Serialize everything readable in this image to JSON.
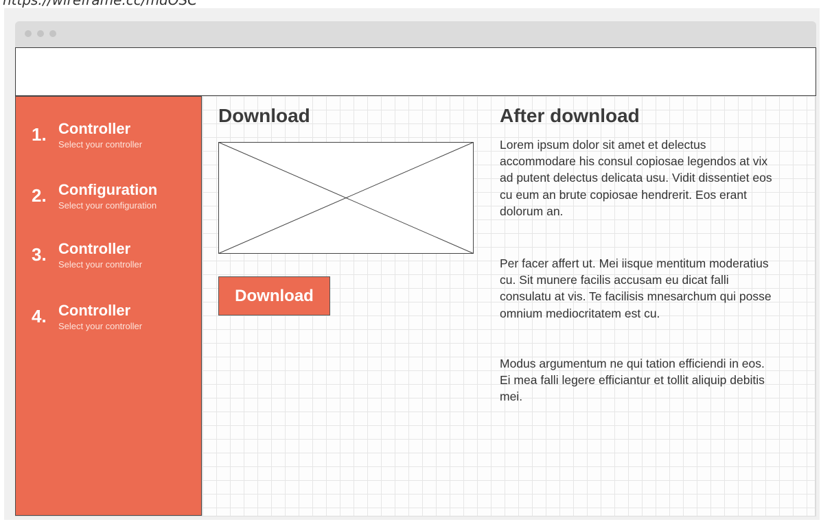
{
  "browser": {
    "url": "https://wireframe.cc/mdOSC"
  },
  "sidebar": {
    "steps": [
      {
        "number": "1.",
        "title": "Controller",
        "subtitle": "Select your controller"
      },
      {
        "number": "2.",
        "title": "Configuration",
        "subtitle": "Select your configuration"
      },
      {
        "number": "3.",
        "title": "Controller",
        "subtitle": "Select your controller"
      },
      {
        "number": "4.",
        "title": "Controller",
        "subtitle": "Select your controller"
      }
    ]
  },
  "main": {
    "download_heading": "Download",
    "download_button": "Download",
    "after_heading": "After download",
    "paragraphs": [
      "Lorem ipsum dolor sit amet et delectus accommodare his consul copiosae legendos at vix ad putent delectus delicata usu. Vidit dissentiet eos cu eum an brute copiosae hendrerit. Eos erant dolorum an.",
      "Per facer affert ut. Mei iisque mentitum moderatius cu. Sit munere facilis accusam eu dicat falli consulatu at vis. Te facilisis mnesarchum qui posse omnium mediocritatem est cu.",
      "Modus argumentum ne qui tation efficiendi in eos. Ei mea falli legere efficiantur et tollit aliquip debitis mei."
    ]
  },
  "colors": {
    "accent": "#ec6b51",
    "heading_text": "#3b3b3b",
    "body_text": "#333333"
  }
}
